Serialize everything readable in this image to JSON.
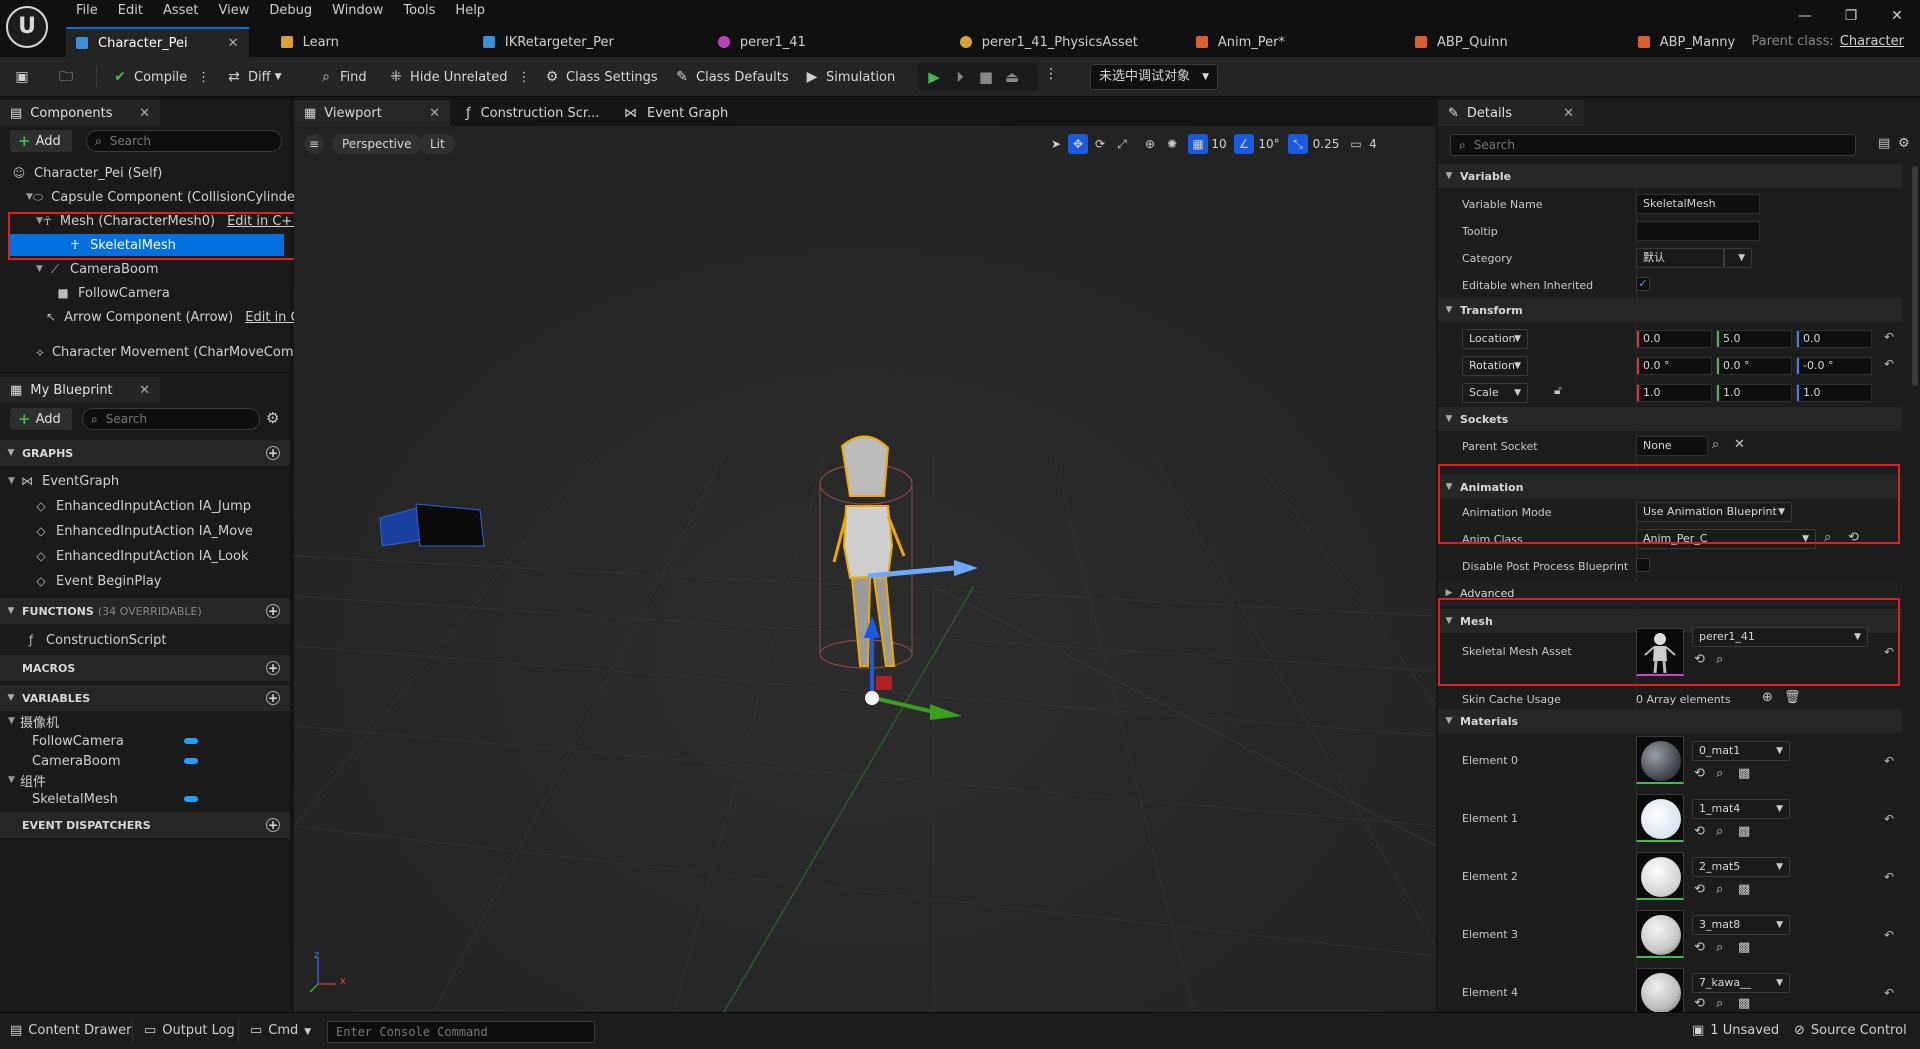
{
  "menu": [
    "File",
    "Edit",
    "Asset",
    "View",
    "Debug",
    "Window",
    "Tools",
    "Help"
  ],
  "doc_tabs": [
    {
      "label": "Character_Pei",
      "color": "#3d8fd8"
    },
    {
      "label": "Learn",
      "color": "#d8a030"
    },
    {
      "label": "IKRetargeter_Per",
      "color": "#3d8fd8"
    },
    {
      "label": "perer1_41",
      "color": "#c040c0"
    },
    {
      "label": "perer1_41_PhysicsAsset",
      "color": "#d8a030"
    },
    {
      "label": "Anim_Per*",
      "color": "#d86030"
    },
    {
      "label": "ABP_Quinn",
      "color": "#d86030"
    },
    {
      "label": "ABP_Manny",
      "color": "#d86030"
    }
  ],
  "parent_class": {
    "label": "Parent class:",
    "value": "Character"
  },
  "toolbar": {
    "compile": "Compile",
    "diff": "Diff",
    "find": "Find",
    "hide_unrelated": "Hide Unrelated",
    "class_settings": "Class Settings",
    "class_defaults": "Class Defaults",
    "simulation": "Simulation",
    "debug_target": "未选中调试对象"
  },
  "components": {
    "tab": "Components",
    "add": "Add",
    "search_placeholder": "Search",
    "tree": [
      {
        "label": "Character_Pei (Self)",
        "edit": ""
      },
      {
        "label": "Capsule Component (CollisionCylinder)",
        "edit": ""
      },
      {
        "label": "Mesh (CharacterMesh0)",
        "edit": "Edit in C++"
      },
      {
        "label": "SkeletalMesh",
        "edit": ""
      },
      {
        "label": "CameraBoom",
        "edit": ""
      },
      {
        "label": "FollowCamera",
        "edit": ""
      },
      {
        "label": "Arrow Component (Arrow)",
        "edit": "Edit in C++"
      },
      {
        "label": "Character Movement (CharMoveComp)",
        "edit": ""
      }
    ]
  },
  "my_blueprint": {
    "tab": "My Blueprint",
    "add": "Add",
    "search_placeholder": "Search",
    "graphs_header": "GRAPHS",
    "graphs": [
      "EventGraph",
      "EnhancedInputAction IA_Jump",
      "EnhancedInputAction IA_Move",
      "EnhancedInputAction IA_Look",
      "Event BeginPlay"
    ],
    "functions_header": "FUNCTIONS",
    "functions_sub": "(34 OVERRIDABLE)",
    "functions": [
      "ConstructionScript"
    ],
    "macros_header": "MACROS",
    "variables_header": "VARIABLES",
    "var_groups": [
      {
        "name": "摄像机",
        "vars": [
          "FollowCamera",
          "CameraBoom"
        ]
      },
      {
        "name": "组件",
        "vars": [
          "SkeletalMesh"
        ]
      }
    ],
    "dispatchers_header": "EVENT DISPATCHERS"
  },
  "viewport": {
    "tabs": [
      "Viewport",
      "Construction Scr...",
      "Event Graph"
    ],
    "perspective": "Perspective",
    "lit": "Lit",
    "grid_snap": "10",
    "rot_snap": "10°",
    "scale_snap": "0.25",
    "cam_speed": "4",
    "axis_x": "x",
    "axis_z": "z"
  },
  "details": {
    "tab": "Details",
    "search_placeholder": "Search",
    "variable_header": "Variable",
    "variable_name_label": "Variable Name",
    "variable_name": "SkeletalMesh",
    "tooltip_label": "Tooltip",
    "tooltip": "",
    "category_label": "Category",
    "category": "默认",
    "editable_label": "Editable when Inherited",
    "transform_header": "Transform",
    "location_label": "Location",
    "location": [
      "0.0",
      "5.0",
      "0.0"
    ],
    "rotation_label": "Rotation",
    "rotation": [
      "0.0 °",
      "0.0 °",
      "-0.0 °"
    ],
    "scale_label": "Scale",
    "scale": [
      "1.0",
      "1.0",
      "1.0"
    ],
    "sockets_header": "Sockets",
    "parent_socket_label": "Parent Socket",
    "parent_socket": "None",
    "animation_header": "Animation",
    "anim_mode_label": "Animation Mode",
    "anim_mode": "Use Animation Blueprint",
    "anim_class_label": "Anim Class",
    "anim_class": "Anim_Per_C",
    "disable_pp_label": "Disable Post Process Blueprint",
    "advanced_label": "Advanced",
    "mesh_header": "Mesh",
    "skel_mesh_label": "Skeletal Mesh Asset",
    "skel_mesh": "perer1_41",
    "skin_cache_label": "Skin Cache Usage",
    "skin_cache": "0 Array elements",
    "materials_header": "Materials",
    "materials": [
      {
        "label": "Element 0",
        "value": "0_mat1"
      },
      {
        "label": "Element 1",
        "value": "1_mat4"
      },
      {
        "label": "Element 2",
        "value": "2_mat5"
      },
      {
        "label": "Element 3",
        "value": "3_mat8"
      },
      {
        "label": "Element 4",
        "value": "7_kawa__"
      }
    ]
  },
  "statusbar": {
    "content_drawer": "Content Drawer",
    "output_log": "Output Log",
    "cmd": "Cmd",
    "console_placeholder": "Enter Console Command",
    "unsaved": "1 Unsaved",
    "source_control": "Source Control"
  }
}
